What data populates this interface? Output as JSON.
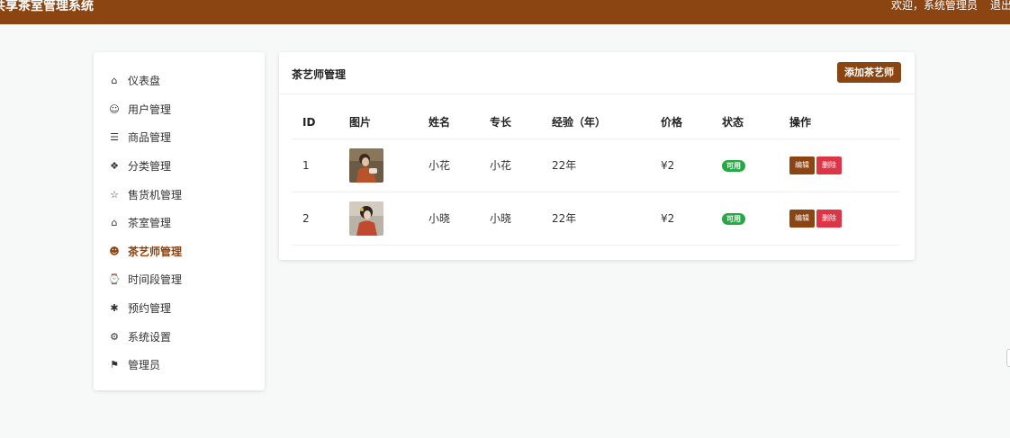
{
  "header": {
    "title": "共享茶室管理系统",
    "welcome": "欢迎，系统管理员",
    "logout": "退出"
  },
  "sidebar": {
    "items": [
      {
        "label": "仪表盘",
        "icon": "home-icon",
        "glyph": "⌂"
      },
      {
        "label": "用户管理",
        "icon": "user-icon",
        "glyph": "☺"
      },
      {
        "label": "商品管理",
        "icon": "list-icon",
        "glyph": "☰"
      },
      {
        "label": "分类管理",
        "icon": "grid-icon",
        "glyph": "❖"
      },
      {
        "label": "售货机管理",
        "icon": "star-icon",
        "glyph": "☆"
      },
      {
        "label": "茶室管理",
        "icon": "house-icon",
        "glyph": "⌂"
      },
      {
        "label": "茶艺师管理",
        "icon": "tea-master-icon",
        "glyph": "☻",
        "active": true
      },
      {
        "label": "时间段管理",
        "icon": "clock-icon",
        "glyph": "⌚"
      },
      {
        "label": "预约管理",
        "icon": "asterisk-icon",
        "glyph": "✱"
      },
      {
        "label": "系统设置",
        "icon": "gear-icon",
        "glyph": "⚙"
      },
      {
        "label": "管理员",
        "icon": "flag-icon",
        "glyph": "⚑"
      }
    ]
  },
  "main": {
    "title": "茶艺师管理",
    "add_button": "添加茶艺师",
    "columns": [
      "ID",
      "图片",
      "姓名",
      "专长",
      "经验（年）",
      "价格",
      "状态",
      "操作"
    ],
    "rows": [
      {
        "id": "1",
        "name": "小花",
        "specialty": "小花",
        "experience": "22年",
        "price": "¥2",
        "status": "可用",
        "edit": "编辑",
        "delete": "删除"
      },
      {
        "id": "2",
        "name": "小晓",
        "specialty": "小晓",
        "experience": "22年",
        "price": "¥2",
        "status": "可用",
        "edit": "编辑",
        "delete": "删除"
      }
    ]
  },
  "colors": {
    "brand": "#8b4513",
    "success": "#28a745",
    "danger": "#dc3545"
  }
}
